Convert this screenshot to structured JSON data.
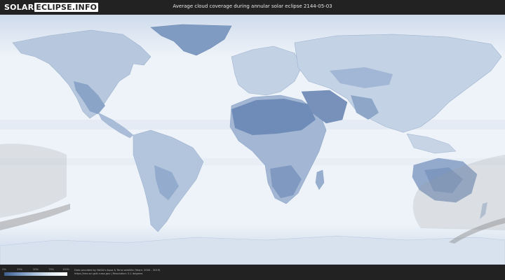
{
  "header": {
    "logo_part1": "SOLAR",
    "logo_part2": "ECLIPSE.INFO",
    "title": "Average cloud coverage during annular solar eclipse 2144-05-03"
  },
  "legend": {
    "ticks": [
      "0%",
      "25%",
      "50%",
      "75%",
      "100%"
    ],
    "colors": [
      "#3d5f8e",
      "#7594bd",
      "#b0c4dd",
      "#e4ebf3",
      "#ffffff"
    ]
  },
  "footer": {
    "credit_line1": "Data provided by NASA's Aqua & Terra satellite (Years: 2000 - 2019)",
    "credit_line2": "https://neo.sci.gsfc.nasa.gov  |  Resolution: 0.1 degrees"
  },
  "colors": {
    "background": "#222222",
    "ocean_cloud": "#eef3f9",
    "land_clear": "#7d97bf",
    "land_partly": "#a9bcd8",
    "eclipse_path_shade": "#9a9a9a"
  },
  "icons": [
    "world-map"
  ]
}
